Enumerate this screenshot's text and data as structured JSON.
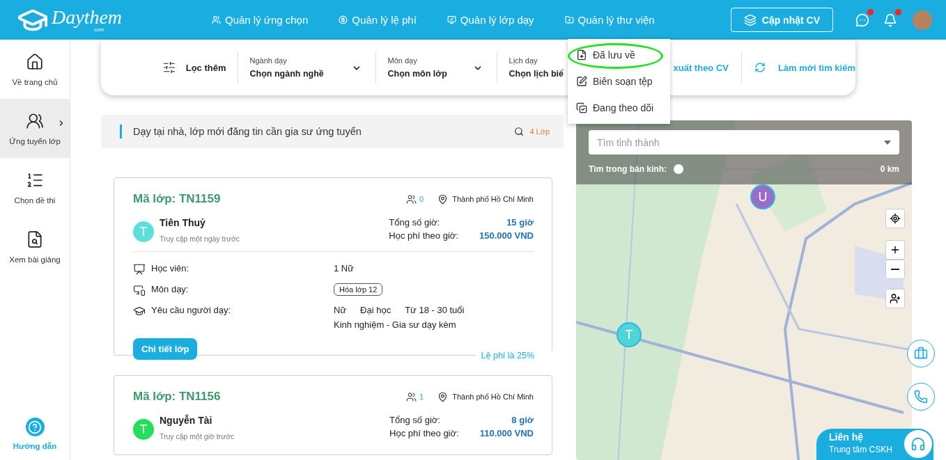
{
  "header": {
    "logo": {
      "text": "Daythem",
      "sub": ".com"
    },
    "nav": [
      {
        "label": "Quản lý ứng chọn"
      },
      {
        "label": "Quản lý lệ phí"
      },
      {
        "label": "Quản lý lớp dạy"
      },
      {
        "label": "Quản lý thư viện"
      }
    ],
    "cv_button": "Cập nhật CV",
    "chat_unread": true,
    "bell_unread": true
  },
  "library_menu": [
    {
      "label": "Đã lưu về",
      "highlighted": true
    },
    {
      "label": "Biên soạn tệp",
      "highlighted": false
    },
    {
      "label": "Đang theo dõi",
      "highlighted": false
    }
  ],
  "sidebar": {
    "items": [
      {
        "label": "Về trang chủ",
        "selected": false
      },
      {
        "label": "Ứng tuyển lớp",
        "selected": true
      },
      {
        "label": "Chọn đề thi",
        "selected": false
      },
      {
        "label": "Xem bài giảng",
        "selected": false
      }
    ],
    "help": "Hướng dẫn"
  },
  "filter": {
    "label": "Lọc thêm",
    "fields": [
      {
        "label": "Ngành dạy",
        "value": "Chọn ngành nghề"
      },
      {
        "label": "Môn dạy",
        "value": "Chọn môn lớp"
      },
      {
        "label": "Lịch dạy",
        "value": "Chọn lịch biể"
      }
    ],
    "cv_action": "xuất theo CV",
    "reset_action": "Làm mới tìm kiếm"
  },
  "list_header": {
    "title": "Dạy tại nhà, lớp mới đăng tin cần gia sư ứng tuyển",
    "count": "4 Lớp"
  },
  "classes": [
    {
      "code": "Mã lớp: TN1159",
      "applicants": "0",
      "location": "Thành phố Hồ Chí Minh",
      "avatar": "T",
      "color": "#5ce0dc",
      "name": "Tiên Thuỷ",
      "last_seen": "Truy cập một ngày trước",
      "hours_label": "Tổng số giờ:",
      "hours": "15 giờ",
      "fee_label": "Học phí theo giờ:",
      "fee": "150.000 VND",
      "details": [
        {
          "kind": "text",
          "label": "Học viên:",
          "values": [
            "1 Nữ"
          ]
        },
        {
          "kind": "tag",
          "label": "Môn dạy:",
          "values": [
            "Hóa lớp 12"
          ]
        },
        {
          "kind": "req",
          "label": "Yêu cầu người dạy:",
          "values": [
            "Nữ",
            "Đại học",
            "Từ 18 - 30 tuổi"
          ],
          "extra": "Kinh nghiệm - Gia sư dạy kèm"
        }
      ],
      "button": "Chi tiết lớp",
      "fee_note": "Lệ phí là 25%"
    },
    {
      "code": "Mã lớp: TN1156",
      "applicants": "1",
      "location": "Thành phố Hồ Chí Minh",
      "avatar": "T",
      "color": "#22e05a",
      "name": "Nguyễn Tài",
      "last_seen": "Truy cập một giờ trước",
      "hours_label": "Tổng số giờ:",
      "hours": "8 giờ",
      "fee_label": "Học phí theo giờ:",
      "fee": "110.000 VND"
    }
  ],
  "map": {
    "search_placeholder": "Tìm tỉnh thành",
    "radius_label": "Tìm trong bán kính:",
    "radius": {
      "level": 0
    },
    "radius_reading": "0 km",
    "pins": [
      {
        "letter": "U",
        "color": "#9b6cc8"
      },
      {
        "letter": "T",
        "color": "#4fd4d8"
      }
    ]
  },
  "contact": {
    "title": "Liên hệ",
    "subtitle": "Trung tâm CSKH"
  }
}
